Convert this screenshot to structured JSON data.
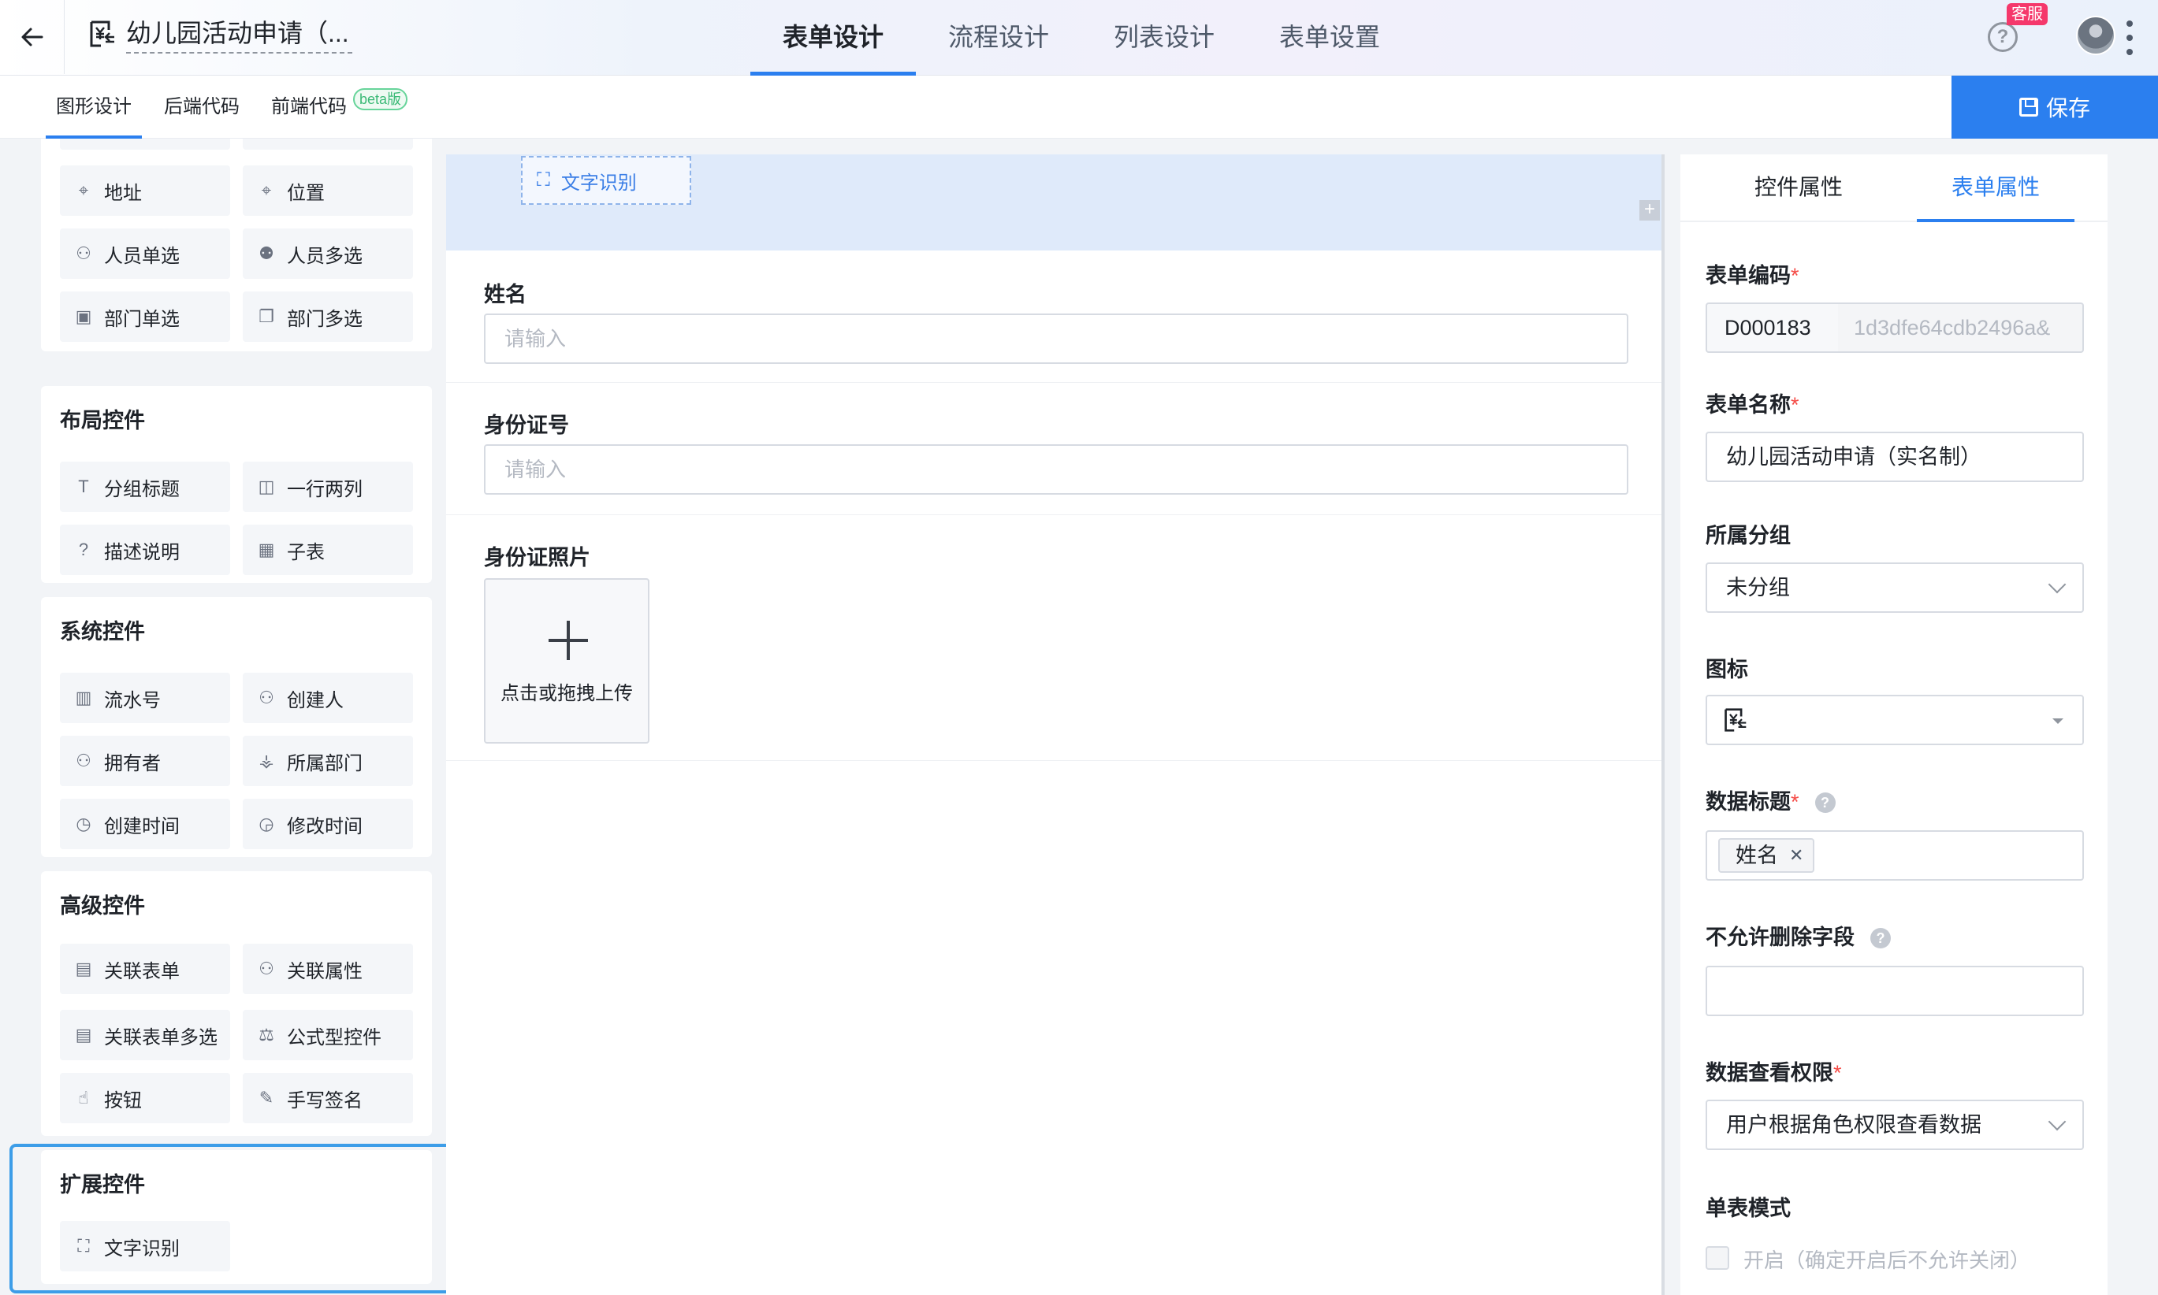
{
  "header": {
    "title": "幼儿园活动申请（...",
    "tabs": [
      {
        "label": "表单设计",
        "active": true
      },
      {
        "label": "流程设计",
        "active": false
      },
      {
        "label": "列表设计",
        "active": false
      },
      {
        "label": "表单设置",
        "active": false
      }
    ],
    "help_glyph": "?",
    "kefu_badge": "客服"
  },
  "subheader": {
    "tabs": [
      {
        "label": "图形设计",
        "active": true
      },
      {
        "label": "后端代码",
        "active": false
      },
      {
        "label": "前端代码",
        "active": false
      }
    ],
    "beta_badge": "beta版",
    "save_label": "保存"
  },
  "left_panel": {
    "basic_items": [
      {
        "label": "地址",
        "icon": "location-pin-icon"
      },
      {
        "label": "位置",
        "icon": "map-marker-icon"
      },
      {
        "label": "人员单选",
        "icon": "user-icon"
      },
      {
        "label": "人员多选",
        "icon": "users-icon"
      },
      {
        "label": "部门单选",
        "icon": "department-icon"
      },
      {
        "label": "部门多选",
        "icon": "departments-icon"
      }
    ],
    "layout": {
      "title": "布局控件",
      "items": [
        {
          "label": "分组标题",
          "icon": "text-t-icon"
        },
        {
          "label": "一行两列",
          "icon": "columns-icon"
        },
        {
          "label": "描述说明",
          "icon": "question-circle-icon"
        },
        {
          "label": "子表",
          "icon": "table-icon"
        }
      ]
    },
    "system": {
      "title": "系统控件",
      "items": [
        {
          "label": "流水号",
          "icon": "barcode-icon"
        },
        {
          "label": "创建人",
          "icon": "user-icon"
        },
        {
          "label": "拥有者",
          "icon": "user-owner-icon"
        },
        {
          "label": "所属部门",
          "icon": "org-tree-icon"
        },
        {
          "label": "创建时间",
          "icon": "clock-icon"
        },
        {
          "label": "修改时间",
          "icon": "clock-edit-icon"
        }
      ]
    },
    "advanced": {
      "title": "高级控件",
      "items": [
        {
          "label": "关联表单",
          "icon": "linked-form-icon"
        },
        {
          "label": "关联属性",
          "icon": "user-link-icon"
        },
        {
          "label": "关联表单多选",
          "icon": "linked-forms-icon"
        },
        {
          "label": "公式型控件",
          "icon": "scale-icon"
        },
        {
          "label": "按钮",
          "icon": "hand-pointer-icon"
        },
        {
          "label": "手写签名",
          "icon": "pen-icon"
        }
      ]
    },
    "extension": {
      "title": "扩展控件",
      "items": [
        {
          "label": "文字识别",
          "icon": "ocr-scan-icon"
        }
      ]
    }
  },
  "canvas": {
    "drag_ghost_label": "文字识别",
    "fields": [
      {
        "label": "姓名",
        "placeholder": "请输入"
      },
      {
        "label": "身份证号",
        "placeholder": "请输入"
      },
      {
        "label": "身份证照片",
        "upload_text": "点击或拖拽上传"
      }
    ]
  },
  "right_panel": {
    "tabs": [
      {
        "label": "控件属性",
        "active": false
      },
      {
        "label": "表单属性",
        "active": true
      }
    ],
    "form_code_label": "表单编码",
    "form_code_prefix": "D000183",
    "form_code_suffix": "1d3dfe64cdb2496a&",
    "form_name_label": "表单名称",
    "form_name_value": "幼儿园活动申请（实名制）",
    "group_label": "所属分组",
    "group_value": "未分组",
    "icon_label": "图标",
    "data_title_label": "数据标题",
    "data_title_tag": "姓名",
    "no_delete_label": "不允许删除字段",
    "view_perm_label": "数据查看权限",
    "view_perm_value": "用户根据角色权限查看数据",
    "single_mode_label": "单表模式",
    "single_mode_checkbox": "开启（确定开启后不允许关闭）",
    "required_mark": "*",
    "help_mark": "?"
  },
  "colors": {
    "accent": "#2b7fef",
    "drop_zone": "#dfeafa",
    "highlight_border": "#3d9de8",
    "required": "#f54a45",
    "badge_red": "#f5386b",
    "beta_green": "#3cba77"
  }
}
